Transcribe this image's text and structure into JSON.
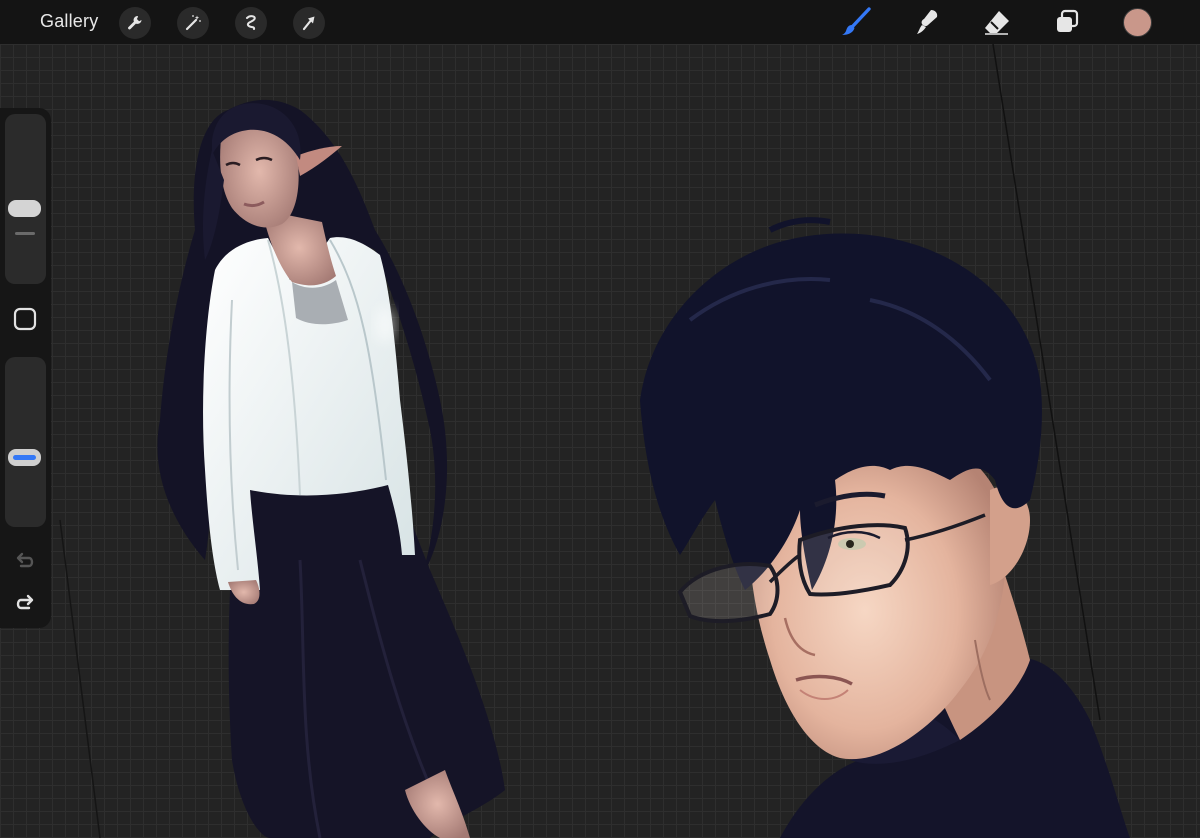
{
  "topbar": {
    "gallery_label": "Gallery",
    "left_tools": [
      {
        "icon": "wrench-icon",
        "name": "actions"
      },
      {
        "icon": "magic-wand-icon",
        "name": "adjustments"
      },
      {
        "icon": "selection-icon",
        "name": "selection"
      },
      {
        "icon": "arrow-cursor-icon",
        "name": "transform"
      }
    ],
    "right_tools": [
      {
        "icon": "brush-icon",
        "name": "paint",
        "active": true
      },
      {
        "icon": "smudge-icon",
        "name": "smudge",
        "active": false
      },
      {
        "icon": "eraser-icon",
        "name": "eraser",
        "active": false
      },
      {
        "icon": "layers-icon",
        "name": "layers",
        "active": false
      }
    ],
    "current_color": "#c9978a"
  },
  "sidebar": {
    "brush_size_icon": "brush-size-slider",
    "opacity_icon": "opacity-slider",
    "modify_icon": "square-modify-icon",
    "undo_icon": "undo-icon",
    "redo_icon": "redo-icon",
    "accent": "#3478f6"
  },
  "colors": {
    "accent": "#3478f6",
    "toolbar": "#141414",
    "canvas": "#232323"
  }
}
